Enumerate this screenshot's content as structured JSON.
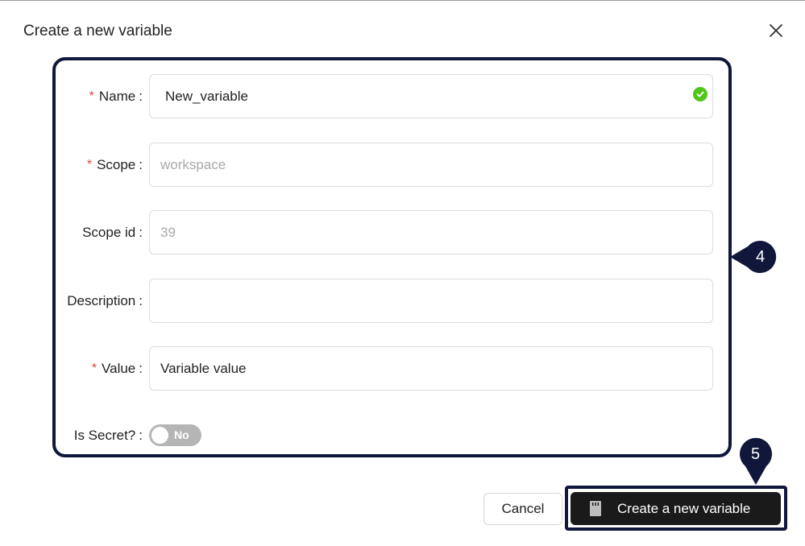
{
  "dialog": {
    "title": "Create a new variable"
  },
  "form": {
    "name": {
      "label": "Name",
      "value": "New_variable",
      "required": true
    },
    "scope": {
      "label": "Scope",
      "value": "workspace",
      "required": true
    },
    "scope_id": {
      "label": "Scope id",
      "value": "39"
    },
    "description": {
      "label": "Description",
      "value": ""
    },
    "value": {
      "label": "Value",
      "value": "Variable value",
      "required": true
    },
    "is_secret": {
      "label": "Is Secret?",
      "toggle_text": "No"
    },
    "colon": ":",
    "required_mark": "*"
  },
  "annotations": {
    "step4": "4",
    "step5": "5"
  },
  "buttons": {
    "cancel": "Cancel",
    "create": "Create a new variable"
  },
  "colors": {
    "annotation": "#10173a",
    "required": "#e0443a",
    "valid": "#52c41a",
    "primary_button": "#1a1a1a"
  },
  "icons": {
    "close": "close-icon",
    "valid": "check-circle-icon",
    "create": "save-icon"
  }
}
